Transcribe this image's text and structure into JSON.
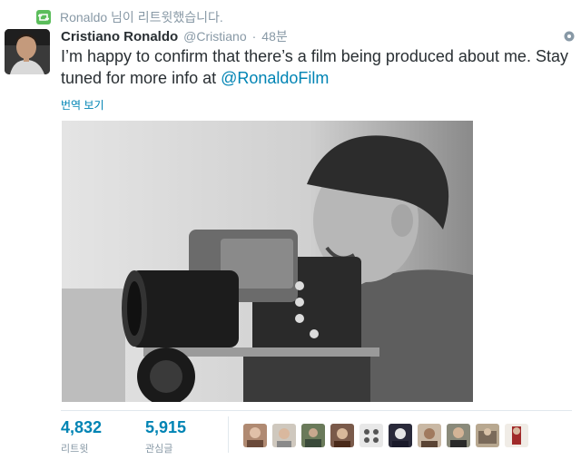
{
  "retweet_context": {
    "text": "Ronaldo 님이 리트윗했습니다.",
    "icon": "retweet-icon",
    "color": "#5bbd5b"
  },
  "author": {
    "fullname": "Cristiano Ronaldo",
    "username": "@Cristiano",
    "separator": "·",
    "time": "48분"
  },
  "tweet": {
    "text": "I’m happy to confirm that there’s a film being produced about me. Stay tuned for more info at ",
    "mention": "@RonaldoFilm"
  },
  "translate_link": "번역 보기",
  "stats": {
    "retweets": {
      "value": "4,832",
      "label": "리트윗"
    },
    "favorites": {
      "value": "5,915",
      "label": "관심글"
    }
  },
  "favoriters_count_shown": 10,
  "colors": {
    "link": "#0084b4",
    "muted": "#8899a6",
    "text": "#292f33"
  }
}
